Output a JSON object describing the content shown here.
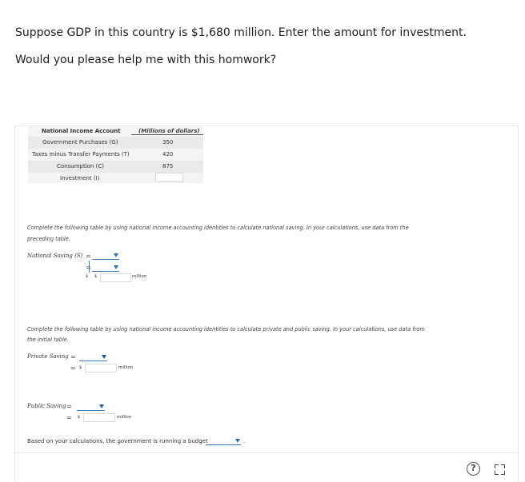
{
  "question": {
    "line1": "Suppose GDP in this country is $1,680 million. Enter the amount for investment.",
    "line2": "Would you please help me with this homwork?"
  },
  "table": {
    "col1_header": "National Income Account",
    "col2_header": "(Millions of dollars)",
    "rows": [
      {
        "label": "Government Purchases (G)",
        "value": "350"
      },
      {
        "label": "Taxes minus Transfer Payments (T)",
        "value": "420"
      },
      {
        "label": "Consumption (C)",
        "value": "875"
      },
      {
        "label": "Investment (I)",
        "value": ""
      }
    ]
  },
  "section1": {
    "instruction_line1": "Complete the following table by using national income accounting identities to calculate national saving. In your calculations, use data from the",
    "instruction_line2": "preceding table.",
    "label": "National Saving (S)",
    "equals": "=",
    "dollar": "$",
    "unit": "million"
  },
  "section2": {
    "instruction_line1": "Complete the following table by using national income accounting identities to calculate private and public saving. In your calculations, use data from",
    "instruction_line2": "the initial table.",
    "private_label": "Private Saving",
    "public_label": "Public Saving",
    "equals": "=",
    "dollar": "$",
    "unit": "million",
    "budget_text": "Based on your calculations, the government is running a budget",
    "period": "."
  },
  "footer": {
    "help_icon": "question-circle-icon",
    "help_glyph": "?",
    "expand_icon": "expand-icon"
  }
}
